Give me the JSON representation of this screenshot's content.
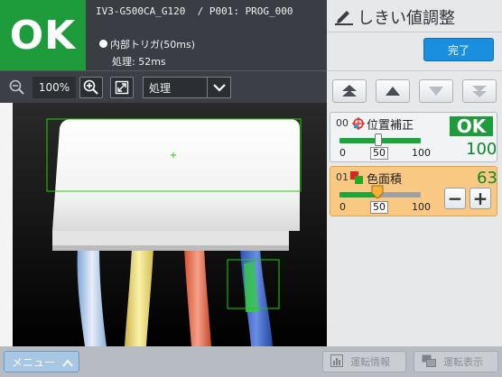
{
  "header": {
    "result": "OK",
    "result_color": "#1e9b3a",
    "device_line": "IV3-G500CA_G120  / P001: PROG_000",
    "trigger": "内部トリガ(50ms)",
    "process_time": "処理: 52ms"
  },
  "image_toolbar": {
    "zoom_out_icon": "zoom-out",
    "zoom_value": "100%",
    "zoom_in_icon": "zoom-in",
    "fit_icon": "fit-screen",
    "view_mode": "処理"
  },
  "panel": {
    "title_icon": "pencil-slider",
    "title": "しきい値調整",
    "done_label": "完了",
    "arrow_buttons": [
      "move-top",
      "move-up",
      "move-down",
      "move-bottom"
    ]
  },
  "tools": [
    {
      "index": "00",
      "name": "位置補正",
      "icon": "position-adjust",
      "result": "OK",
      "value": "100",
      "threshold": 50,
      "min": "0",
      "max": "100",
      "threshold_label": "50"
    },
    {
      "index": "01",
      "name": "色面積",
      "icon": "color-area",
      "value": "63",
      "threshold": 50,
      "min": "0",
      "max": "100",
      "threshold_label": "50",
      "minus": "−",
      "plus": "+"
    }
  ],
  "bottom": {
    "menu_label": "メニュー",
    "run_info_label": "運転情報",
    "run_display_label": "運転表示"
  },
  "colors": {
    "ok_green": "#1e9b3a",
    "accent_blue": "#1a8fe0",
    "selected_card": "#f9c983",
    "roi_green": "#1fd000"
  }
}
